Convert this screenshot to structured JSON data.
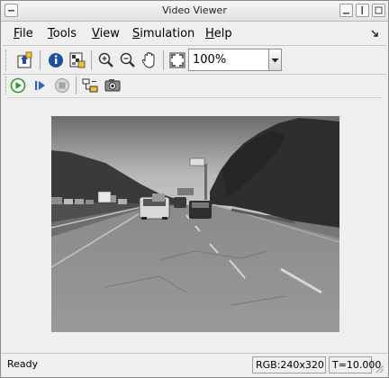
{
  "window": {
    "title": "Video Viewer"
  },
  "menu": [
    {
      "label": "File",
      "mnemonic": "F",
      "rest": "ile"
    },
    {
      "label": "Tools",
      "mnemonic": "T",
      "rest": "ools"
    },
    {
      "label": "View",
      "mnemonic": "V",
      "rest": "iew"
    },
    {
      "label": "Simulation",
      "mnemonic": "S",
      "rest": "imulation"
    },
    {
      "label": "Help",
      "mnemonic": "H",
      "rest": "elp"
    }
  ],
  "toolbar": {
    "icons": [
      "parameters-icon",
      "info-icon",
      "pixel-region-icon",
      "zoom-in-icon",
      "zoom-out-icon",
      "pan-hand-icon",
      "fit-to-view-icon"
    ],
    "zoom": {
      "value": "100%"
    }
  },
  "simulation_toolbar": {
    "icons": [
      "play-icon",
      "step-forward-icon",
      "stop-icon",
      "highlight-block-icon",
      "snapshot-icon"
    ]
  },
  "status": {
    "text": "Ready",
    "image_info": "RGB:240x320",
    "time": "T=10.000"
  },
  "colors": {
    "play": "#2c9a2c",
    "step": "#2a63c9",
    "info": "#1f4f9e"
  }
}
